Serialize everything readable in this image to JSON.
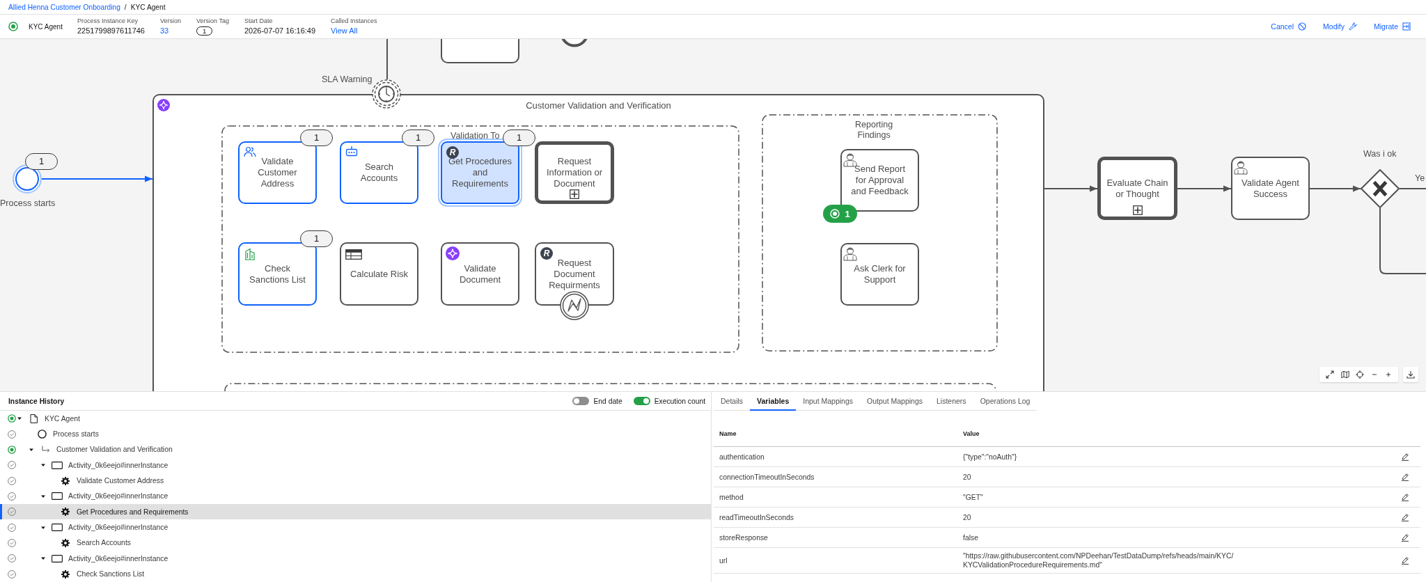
{
  "breadcrumb": {
    "items": [
      {
        "label": "Allied Henna Customer Onboarding",
        "kind": "link"
      },
      {
        "label": "KYC Agent",
        "kind": "current"
      }
    ],
    "separator": "/"
  },
  "instance": {
    "active": true,
    "name": "KYC Agent",
    "fields": [
      {
        "label": "Process Instance Key",
        "value": "2251799897611746",
        "kind": "text"
      },
      {
        "label": "Version",
        "value": "33",
        "kind": "link"
      },
      {
        "label": "Version Tag",
        "value": "1",
        "kind": "tag"
      },
      {
        "label": "Start Date",
        "value": "2026-07-07 16:16:49",
        "kind": "text"
      },
      {
        "label": "Called Instances",
        "value": "View All",
        "kind": "link"
      }
    ]
  },
  "actions": [
    {
      "label": "Cancel",
      "kind": "cancel"
    },
    {
      "label": "Modify",
      "kind": "modify"
    },
    {
      "label": "Migrate",
      "kind": "migrate"
    }
  ],
  "diagram": {
    "start_event": {
      "label": "Process starts",
      "executed": true,
      "badge": {
        "kind": "completed",
        "count": "1"
      }
    },
    "timer_event": {
      "label": "SLA Warning"
    },
    "subprocess": {
      "title": "Customer Validation and Verification"
    },
    "groups": [
      {
        "label": "Validation To"
      },
      {
        "label": "Reporting\nFindings"
      }
    ],
    "tasks": [
      {
        "label": "Validate\nCustomer\nAddress",
        "kind": "people",
        "executed": true,
        "selected": false,
        "badge": {
          "kind": "completed",
          "count": "1"
        }
      },
      {
        "label": "Search\nAccounts",
        "kind": "connector",
        "executed": true,
        "selected": false,
        "badge": {
          "kind": "completed",
          "count": "1"
        }
      },
      {
        "label": "Get Procedures\nand\nRequirements",
        "kind": "rest",
        "marker": "R",
        "executed": true,
        "selected": true,
        "badge": {
          "kind": "completed",
          "count": "1"
        }
      },
      {
        "label": "Request\nInformation or\nDocument",
        "kind": "call",
        "executed": false,
        "selected": false
      },
      {
        "label": "Check\nSanctions List",
        "kind": "building",
        "executed": true,
        "selected": false,
        "badge": {
          "kind": "completed",
          "count": "1"
        }
      },
      {
        "label": "Calculate Risk",
        "kind": "rule",
        "executed": false,
        "selected": false
      },
      {
        "label": "Validate\nDocument",
        "kind": "ai",
        "executed": false,
        "selected": false
      },
      {
        "label": "Request\nDocument\nRequirments",
        "kind": "rest",
        "marker": "R",
        "boundary_event": {
          "kind": "error"
        },
        "executed": false,
        "selected": false
      },
      {
        "label": "Send Report\nfor Approval\nand Feedback",
        "kind": "user",
        "executed": false,
        "selected": false,
        "badge": {
          "kind": "active",
          "count": "1"
        }
      },
      {
        "label": "Ask Clerk for\nSupport",
        "kind": "user",
        "executed": false,
        "selected": false
      },
      {
        "label": "Evaluate Chain\nor Thought",
        "kind": "call",
        "executed": false,
        "selected": false
      },
      {
        "label": "Validate Agent\nSuccess",
        "kind": "user",
        "executed": false,
        "selected": false
      }
    ],
    "gateway": {
      "label": "Was i ok",
      "outgoing_label": "Ye"
    }
  },
  "instance_history": {
    "title": "Instance History",
    "toggles": [
      {
        "label": "End date",
        "on": false
      },
      {
        "label": "Execution count",
        "on": true
      }
    ],
    "tree": [
      {
        "label": "KYC Agent",
        "kind": "process",
        "active": true,
        "expanded": true,
        "selected": false,
        "children": [
          {
            "label": "Process starts",
            "kind": "start",
            "active": false,
            "selected": false
          },
          {
            "label": "Customer Validation and Verification",
            "kind": "subprocess",
            "active": true,
            "expanded": true,
            "selected": false,
            "children": [
              {
                "label": "Activity_0k6eejo#innerInstance",
                "kind": "instance",
                "active": false,
                "expanded": true,
                "selected": false,
                "children": [
                  {
                    "label": "Validate Customer Address",
                    "kind": "task",
                    "active": false,
                    "selected": false
                  }
                ]
              },
              {
                "label": "Activity_0k6eejo#innerInstance",
                "kind": "instance",
                "active": false,
                "expanded": true,
                "selected": false,
                "children": [
                  {
                    "label": "Get Procedures and Requirements",
                    "kind": "task",
                    "active": false,
                    "selected": true
                  }
                ]
              },
              {
                "label": "Activity_0k6eejo#innerInstance",
                "kind": "instance",
                "active": false,
                "expanded": true,
                "selected": false,
                "children": [
                  {
                    "label": "Search Accounts",
                    "kind": "task",
                    "active": false,
                    "selected": false
                  }
                ]
              },
              {
                "label": "Activity_0k6eejo#innerInstance",
                "kind": "instance",
                "active": false,
                "expanded": true,
                "selected": false,
                "children": [
                  {
                    "label": "Check Sanctions List",
                    "kind": "task",
                    "active": false,
                    "selected": false
                  }
                ]
              }
            ]
          }
        ]
      }
    ]
  },
  "details": {
    "tabs": [
      {
        "label": "Details",
        "selected": false
      },
      {
        "label": "Variables",
        "selected": true
      },
      {
        "label": "Input Mappings",
        "selected": false
      },
      {
        "label": "Output Mappings",
        "selected": false
      },
      {
        "label": "Listeners",
        "selected": false
      },
      {
        "label": "Operations Log",
        "selected": false
      }
    ],
    "columns": [
      "Name",
      "Value"
    ],
    "rows": [
      {
        "name": "authentication",
        "value": "{\"type\":\"noAuth\"}"
      },
      {
        "name": "connectionTimeoutInSeconds",
        "value": "20"
      },
      {
        "name": "method",
        "value": "\"GET\""
      },
      {
        "name": "readTimeoutInSeconds",
        "value": "20"
      },
      {
        "name": "storeResponse",
        "value": "false"
      },
      {
        "name": "url",
        "value": "\"https://raw.githubusercontent.com/NPDeehan/TestDataDump/refs/heads/main/KYC/\nKYCValidationProcedureRequirements.md\""
      }
    ]
  }
}
